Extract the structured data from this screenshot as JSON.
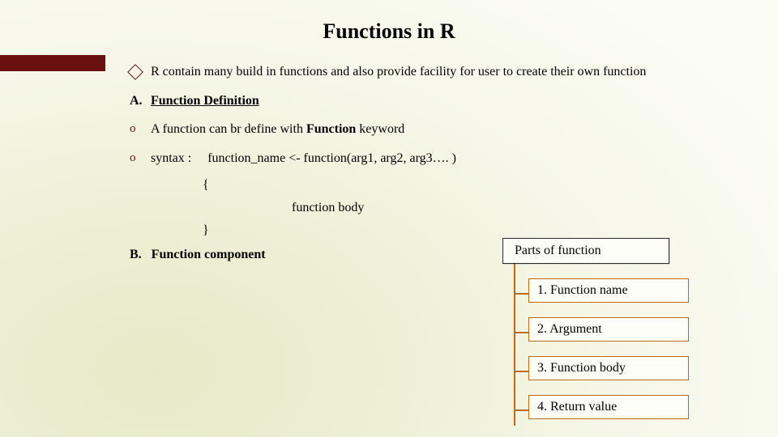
{
  "title": "Functions in R",
  "intro": "R contain many build in functions and also provide facility for user to create their own function",
  "sectionA": {
    "label": "A.",
    "heading": "Function Definition"
  },
  "points": {
    "p1": {
      "bullet": "o",
      "text_pre": "A function can br define with ",
      "kw": "Function",
      "text_post": " keyword"
    },
    "p2": {
      "bullet": "o",
      "label": "syntax :",
      "code": "function_name  <- function(arg1, arg2, arg3…. )"
    }
  },
  "braces": {
    "open": "{",
    "body": "function body",
    "close": "}"
  },
  "sectionB": {
    "label": "B.",
    "heading": "Function component"
  },
  "diagram": {
    "root": "Parts of function",
    "items": [
      "1. Function name",
      "2. Argument",
      "3. Function body",
      "4. Return value"
    ]
  }
}
